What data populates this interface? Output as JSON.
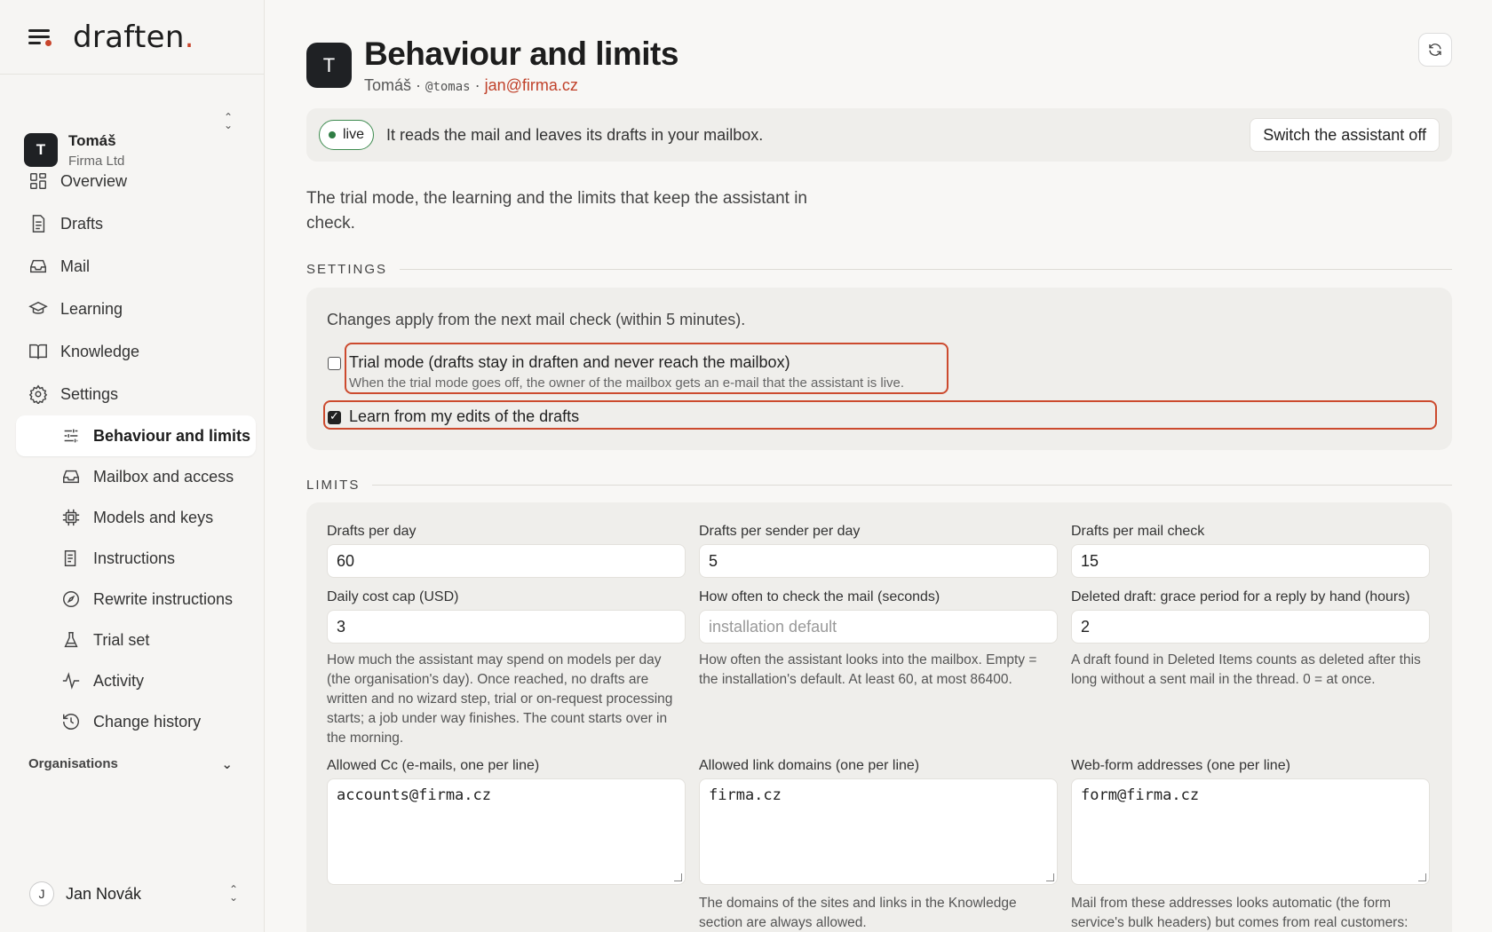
{
  "app": {
    "logo": "draften",
    "logo_dot": "."
  },
  "org_switcher": {
    "initial": "T",
    "name": "Tomáš",
    "sub": "Firma Ltd"
  },
  "nav": {
    "items": [
      {
        "label": "Overview",
        "icon": "grid-icon"
      },
      {
        "label": "Drafts",
        "icon": "document-icon"
      },
      {
        "label": "Mail",
        "icon": "inbox-icon"
      },
      {
        "label": "Learning",
        "icon": "graduation-cap-icon"
      },
      {
        "label": "Knowledge",
        "icon": "book-icon"
      },
      {
        "label": "Settings",
        "icon": "gear-icon"
      }
    ],
    "settings_sub": [
      {
        "label": "Behaviour and limits",
        "icon": "sliders-icon",
        "active": true
      },
      {
        "label": "Mailbox and access",
        "icon": "inbox-icon"
      },
      {
        "label": "Models and keys",
        "icon": "chip-icon"
      },
      {
        "label": "Instructions",
        "icon": "list-icon"
      },
      {
        "label": "Rewrite instructions",
        "icon": "compass-icon"
      },
      {
        "label": "Trial set",
        "icon": "flask-icon"
      },
      {
        "label": "Activity",
        "icon": "pulse-icon"
      },
      {
        "label": "Change history",
        "icon": "history-icon"
      }
    ],
    "organisations_label": "Organisations"
  },
  "user": {
    "initial": "J",
    "name": "Jan Novák"
  },
  "header": {
    "initial": "T",
    "title": "Behaviour and limits",
    "owner": "Tomáš",
    "handle": "@tomas",
    "email": "jan@firma.cz"
  },
  "status": {
    "pill": "live",
    "text": "It reads the mail and leaves its drafts in your mailbox.",
    "switch_off": "Switch the assistant off"
  },
  "intro": "The trial mode, the learning and the limits that keep the assistant in check.",
  "settings": {
    "heading": "SETTINGS",
    "note": "Changes apply from the next mail check (within 5 minutes).",
    "trial_mode": {
      "label": "Trial mode (drafts stay in draften and never reach the mailbox)",
      "help": "When the trial mode goes off, the owner of the mailbox gets an e-mail that the assistant is live.",
      "checked": false
    },
    "learn": {
      "label": "Learn from my edits of the drafts",
      "checked": true
    }
  },
  "limits": {
    "heading": "LIMITS",
    "drafts_per_day": {
      "label": "Drafts per day",
      "value": "60"
    },
    "drafts_per_sender": {
      "label": "Drafts per sender per day",
      "value": "5"
    },
    "drafts_per_check": {
      "label": "Drafts per mail check",
      "value": "15"
    },
    "daily_cost": {
      "label": "Daily cost cap (USD)",
      "value": "3",
      "help": "How much the assistant may spend on models per day (the organisation's day). Once reached, no drafts are written and no wizard step, trial or on-request processing starts; a job under way finishes. The count starts over in the morning."
    },
    "check_interval": {
      "label": "How often to check the mail (seconds)",
      "placeholder": "installation default",
      "help": "How often the assistant looks into the mailbox. Empty = the installation's default. At least 60, at most 86400."
    },
    "grace_period": {
      "label": "Deleted draft: grace period for a reply by hand (hours)",
      "value": "2",
      "help": "A draft found in Deleted Items counts as deleted after this long without a sent mail in the thread. 0 = at once."
    },
    "allowed_cc": {
      "label": "Allowed Cc (e-mails, one per line)",
      "value": "accounts@firma.cz"
    },
    "allowed_domains": {
      "label": "Allowed link domains (one per line)",
      "value": "firma.cz",
      "help": "The domains of the sites and links in the Knowledge section are always allowed."
    },
    "webform": {
      "label": "Web-form addresses (one per line)",
      "value": "form@firma.cz",
      "help": "Mail from these addresses looks automatic (the form service's bulk headers) but comes from real customers:"
    }
  }
}
